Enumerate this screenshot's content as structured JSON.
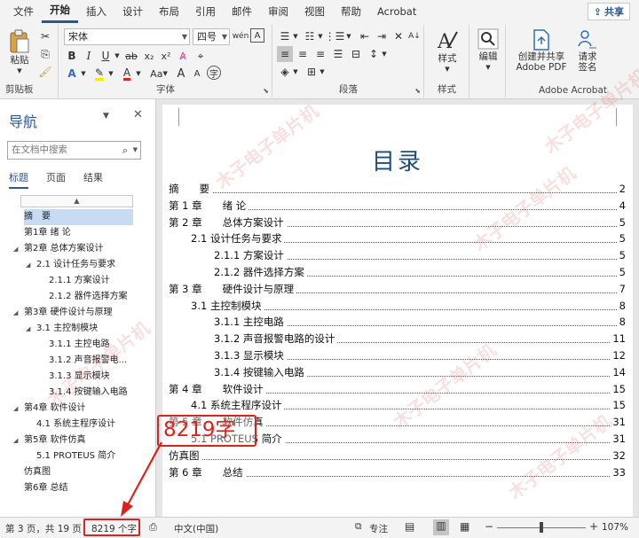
{
  "menu": {
    "tabs": [
      "文件",
      "开始",
      "插入",
      "设计",
      "布局",
      "引用",
      "邮件",
      "审阅",
      "视图",
      "帮助",
      "Acrobat"
    ],
    "active": "开始",
    "share_label": "共享"
  },
  "ribbon": {
    "clipboard": {
      "paste_label": "粘贴",
      "group_label": "剪贴板"
    },
    "font": {
      "font_name": "宋体",
      "font_size": "四号",
      "group_label": "字体",
      "pinyin_label": "wén",
      "case_label": "Aa"
    },
    "paragraph": {
      "group_label": "段落"
    },
    "styles": {
      "label": "样式",
      "group_label": "样式"
    },
    "editing": {
      "label": "编辑"
    },
    "acrobat": {
      "create_pdf_line1": "创建并共享",
      "create_pdf_line2": "Adobe PDF",
      "sign_line1": "请求",
      "sign_line2": "签名",
      "group_label": "Adobe Acrobat"
    }
  },
  "nav": {
    "title": "导航",
    "search_placeholder": "在文档中搜索",
    "tabs": [
      "标题",
      "页面",
      "结果"
    ],
    "active_tab": "标题",
    "items": [
      {
        "text": "摘　要",
        "level": 0,
        "selected": true
      },
      {
        "text": "第1章 绪 论",
        "level": 0
      },
      {
        "text": "第2章 总体方案设计",
        "level": 0,
        "expanded": true
      },
      {
        "text": "2.1 设计任务与要求",
        "level": 1,
        "expanded": true
      },
      {
        "text": "2.1.1 方案设计",
        "level": 2
      },
      {
        "text": "2.1.2 器件选择方案",
        "level": 2
      },
      {
        "text": "第3章 硬件设计与原理",
        "level": 0,
        "expanded": true
      },
      {
        "text": "3.1 主控制模块",
        "level": 1,
        "expanded": true
      },
      {
        "text": "3.1.1 主控电路",
        "level": 2
      },
      {
        "text": "3.1.2 声音报警电...",
        "level": 2
      },
      {
        "text": "3.1.3 显示模块",
        "level": 2
      },
      {
        "text": "3.1.4 按键输入电路",
        "level": 2
      },
      {
        "text": "第4章 软件设计",
        "level": 0,
        "expanded": true
      },
      {
        "text": "4.1 系统主程序设计",
        "level": 1
      },
      {
        "text": "第5章 软件仿真",
        "level": 0,
        "expanded": true
      },
      {
        "text": "5.1 PROTEUS 简介",
        "level": 1
      },
      {
        "text": "仿真图",
        "level": 0
      },
      {
        "text": "第6章 总结",
        "level": 0
      }
    ]
  },
  "doc": {
    "title": "目录",
    "toc": [
      {
        "text": "摘　　要",
        "page": "2",
        "indent": 0
      },
      {
        "text": "第 1 章　　绪 论",
        "page": "4",
        "indent": 0
      },
      {
        "text": "第 2 章　　总体方案设计",
        "page": "5",
        "indent": 0
      },
      {
        "text": "2.1 设计任务与要求",
        "page": "5",
        "indent": 1
      },
      {
        "text": "2.1.1 方案设计",
        "page": "5",
        "indent": 2
      },
      {
        "text": "2.1.2 器件选择方案",
        "page": "5",
        "indent": 2
      },
      {
        "text": "第 3 章　　硬件设计与原理",
        "page": "7",
        "indent": 0
      },
      {
        "text": "3.1 主控制模块",
        "page": "8",
        "indent": 1
      },
      {
        "text": "3.1.1 主控电路",
        "page": "8",
        "indent": 2
      },
      {
        "text": "3.1.2 声音报警电路的设计",
        "page": "11",
        "indent": 2
      },
      {
        "text": "3.1.3 显示模块",
        "page": "12",
        "indent": 2
      },
      {
        "text": "3.1.4 按键输入电路",
        "page": "14",
        "indent": 2
      },
      {
        "text": "第 4 章　　软件设计",
        "page": "15",
        "indent": 0
      },
      {
        "text": "4.1 系统主程序设计",
        "page": "15",
        "indent": 1
      },
      {
        "text": "第 5 章　　软件仿真",
        "page": "31",
        "indent": 0
      },
      {
        "text": "5.1 PROTEUS 简介",
        "page": "31",
        "indent": 1
      },
      {
        "text": "仿真图",
        "page": "32",
        "indent": 0
      },
      {
        "text": "第 6 章　　总结",
        "page": "33",
        "indent": 0
      }
    ]
  },
  "annotation": {
    "word_count_callout": "8219字"
  },
  "watermark": "木子电子单片机",
  "status": {
    "page_info": "第 3 页，共 19 页",
    "word_count": "8219 个字",
    "language": "中文(中国)",
    "focus_label": "专注",
    "zoom": "107%"
  },
  "colors": {
    "accent": "#2b579a",
    "callout": "#e0211b",
    "title": "#1f4e79"
  }
}
